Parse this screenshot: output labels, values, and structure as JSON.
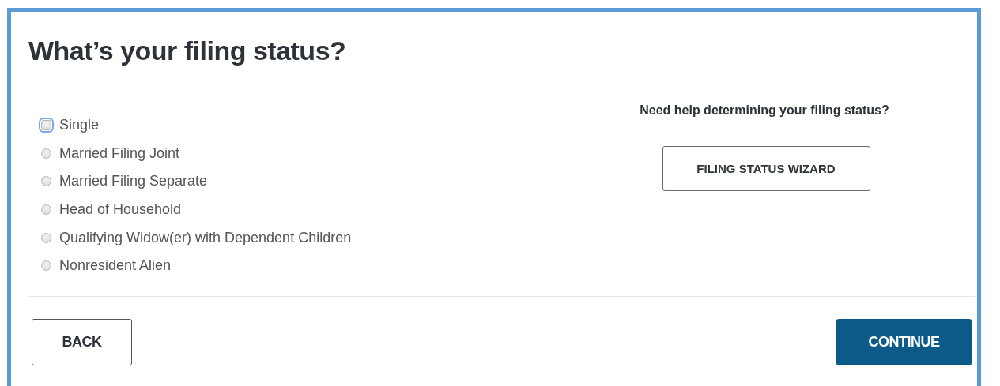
{
  "title": "What’s your filing status?",
  "options": [
    {
      "label": "Single",
      "selected": false,
      "focused": true
    },
    {
      "label": "Married Filing Joint",
      "selected": false,
      "focused": false
    },
    {
      "label": "Married Filing Separate",
      "selected": false,
      "focused": false
    },
    {
      "label": "Head of Household",
      "selected": false,
      "focused": false
    },
    {
      "label": "Qualifying Widow(er) with Dependent Children",
      "selected": false,
      "focused": false
    },
    {
      "label": "Nonresident Alien",
      "selected": false,
      "focused": false
    }
  ],
  "help": {
    "text": "Need help determining your filing status?",
    "button": "FILING STATUS WIZARD"
  },
  "buttons": [
    {
      "kind": "secondary",
      "label": "BACK"
    },
    {
      "kind": "primary",
      "label": "CONTINUE"
    }
  ]
}
